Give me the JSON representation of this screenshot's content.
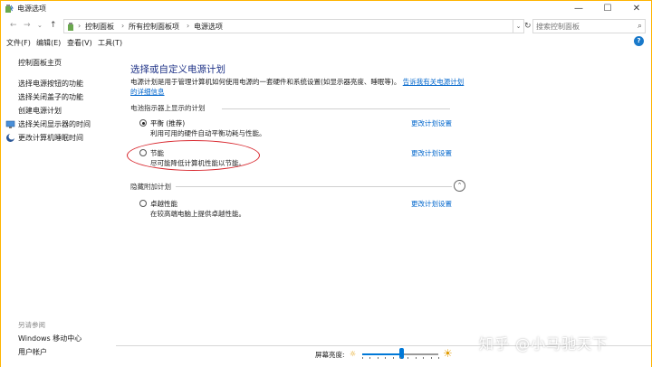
{
  "window": {
    "title": "电源选项",
    "minimize": "—",
    "maximize": "☐",
    "close": "✕"
  },
  "address": {
    "back": "←",
    "forward": "→",
    "recent": "⌄",
    "up": "↑",
    "crumbs": [
      "控制面板",
      "所有控制面板项",
      "电源选项"
    ],
    "separator": "›",
    "dropdown": "⌄",
    "refresh": "↻",
    "search_placeholder": "搜索控制面板"
  },
  "menu": [
    "文件(F)",
    "编辑(E)",
    "查看(V)",
    "工具(T)"
  ],
  "sidebar": {
    "home": "控制面板主页",
    "links": [
      "选择电源按钮的功能",
      "选择关闭盖子的功能",
      "创建电源计划",
      "选择关闭显示器的时间",
      "更改计算机睡眠时间"
    ],
    "see_also_label": "另请参阅",
    "see_also": [
      "Windows 移动中心",
      "用户帐户"
    ]
  },
  "main": {
    "heading": "选择或自定义电源计划",
    "description": "电源计划是用于管理计算机如何使用电源的一套硬件和系统设置(如显示器亮度、睡眠等)。",
    "description_link": "告诉我有关电源计划的详细信息",
    "section_shown": "电池指示器上显示的计划",
    "section_hidden": "隐藏附加计划",
    "change_label": "更改计划设置",
    "plans": [
      {
        "name": "平衡 (推荐)",
        "desc": "利用可用的硬件自动平衡功耗与性能。",
        "selected": true
      },
      {
        "name": "节能",
        "desc": "尽可能降低计算机性能以节能。",
        "selected": false
      },
      {
        "name": "卓越性能",
        "desc": "在较高端电脑上提供卓越性能。",
        "selected": false
      }
    ],
    "expand_icon": "⌃"
  },
  "brightness": {
    "label": "屏幕亮度:",
    "level_fraction": 0.52
  },
  "watermark": "知乎 @小马驰天下",
  "colors": {
    "heading": "#1e3287",
    "link": "#0066cc",
    "annotation": "#d8262d",
    "slider": "#0078d7",
    "window_border": "#ffb400"
  }
}
